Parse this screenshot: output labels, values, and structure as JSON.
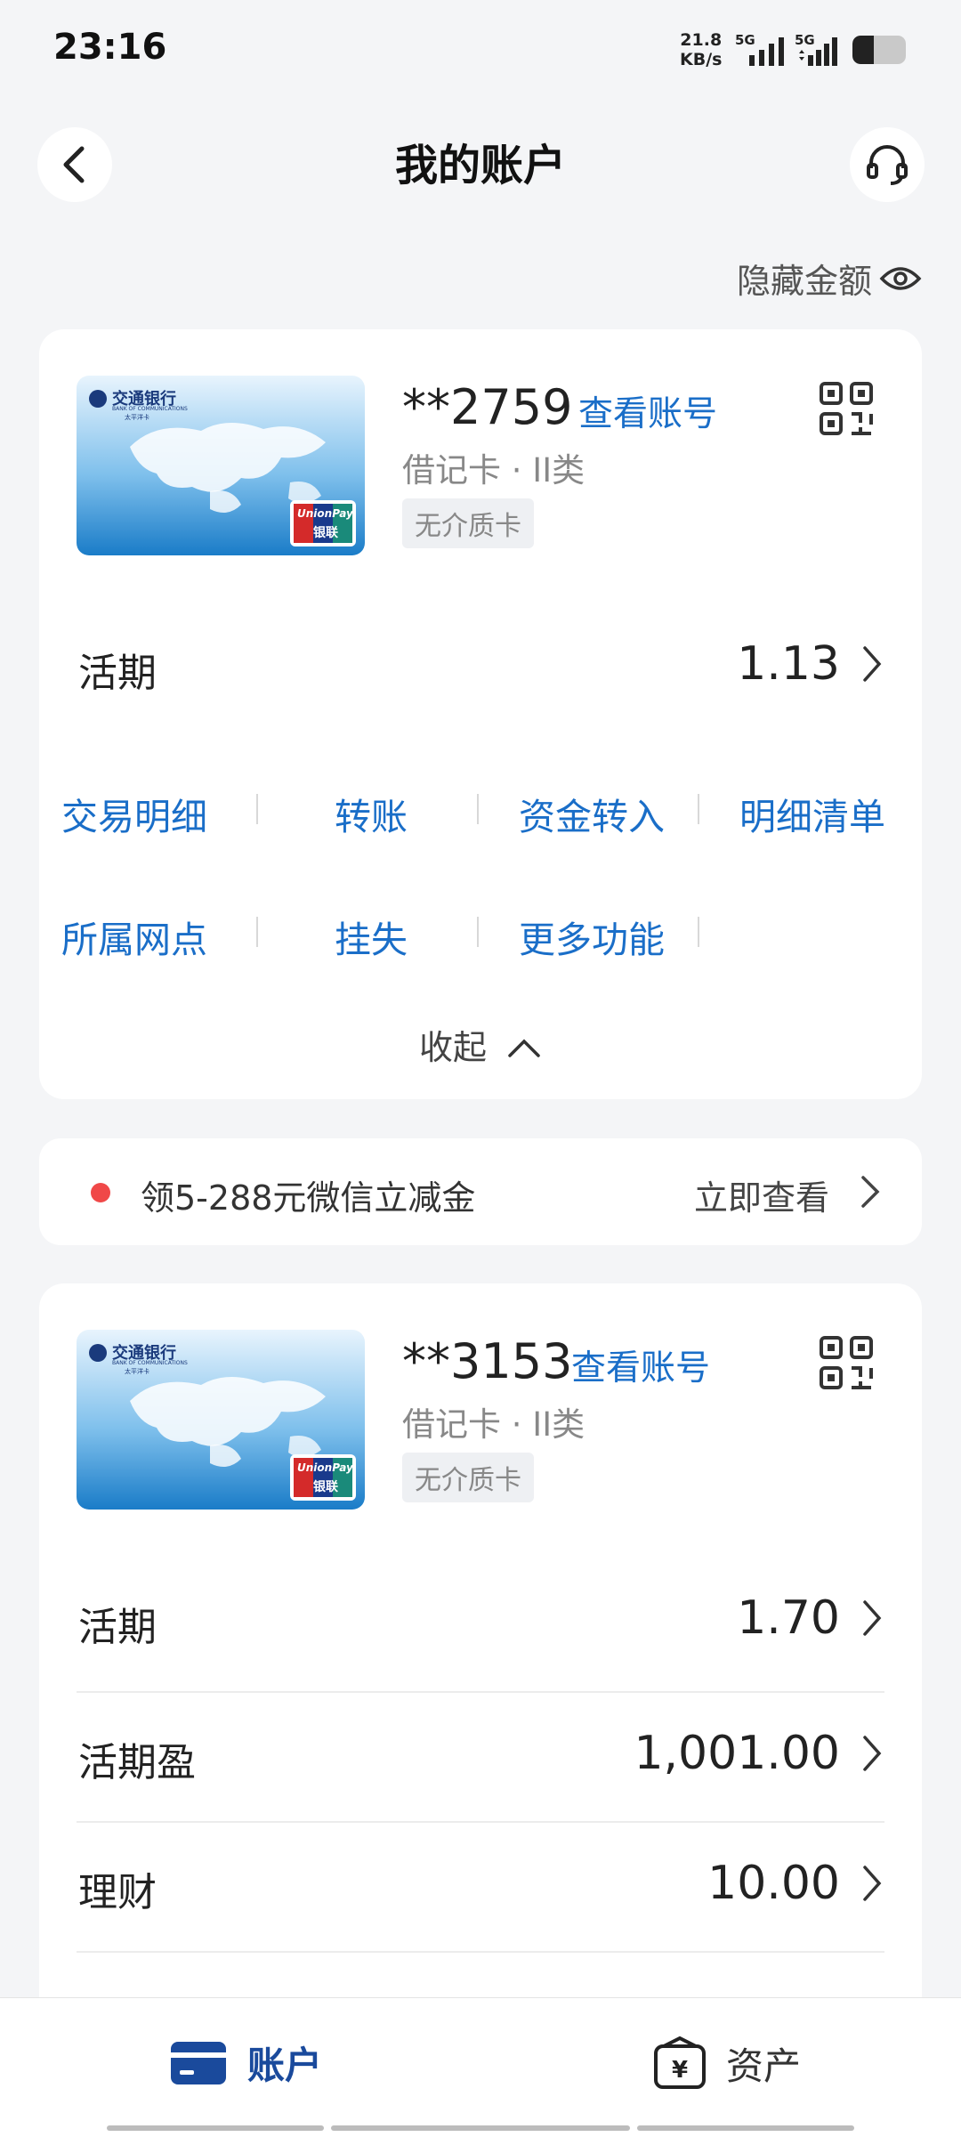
{
  "status_bar": {
    "time": "23:16",
    "speed_value": "21.8",
    "speed_unit": "KB/s",
    "network1": "5G",
    "network2": "5G"
  },
  "header": {
    "title": "我的账户",
    "back_icon": "chevron-left-icon",
    "service_icon": "headset-icon"
  },
  "hide_amount": {
    "label": "隐藏金额",
    "icon": "eye-icon"
  },
  "card1": {
    "account_no": "**2759",
    "view_account": "查看账号",
    "card_type": "借记卡 · II类",
    "tag": "无介质卡",
    "rows": [
      {
        "label": "活期",
        "value": "1.13"
      }
    ],
    "actions": [
      "交易明细",
      "转账",
      "资金转入",
      "明细清单",
      "所属网点",
      "挂失",
      "更多功能"
    ],
    "collapse_label": "收起"
  },
  "bank_card_art": {
    "bank_name": "交通银行",
    "bank_name_en": "BANK OF COMMUNICATIONS",
    "sub_name": "太平洋卡",
    "network_logo": "UnionPay",
    "network_logo_cn": "银联"
  },
  "promo": {
    "text": "领5-288元微信立减金",
    "action": "立即查看",
    "dot_color": "#f04848"
  },
  "card2": {
    "account_no": "**3153",
    "view_account": "查看账号",
    "card_type": "借记卡 · II类",
    "tag": "无介质卡",
    "rows": [
      {
        "label": "活期",
        "value": "1.70"
      },
      {
        "label": "活期盈",
        "value": "1,001.00"
      },
      {
        "label": "理财",
        "value": "10.00"
      }
    ]
  },
  "bottom_nav": [
    {
      "label": "账户",
      "icon": "card-icon",
      "active": true,
      "color": "#1a4a9c"
    },
    {
      "label": "资产",
      "icon": "wallet-yen-icon",
      "active": false
    }
  ],
  "colors": {
    "accent": "#1a6ec8",
    "nav_active": "#1a4a9c"
  }
}
